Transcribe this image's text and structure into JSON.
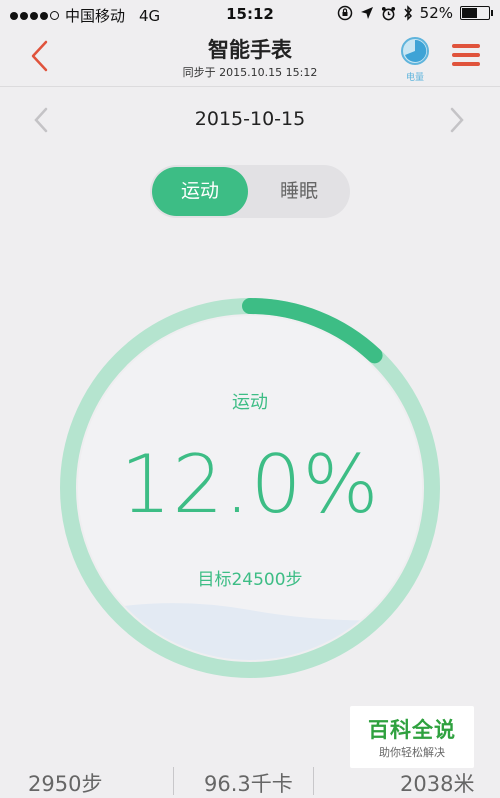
{
  "status_bar": {
    "carrier": "中国移动",
    "network": "4G",
    "time": "15:12",
    "battery": "52%"
  },
  "header": {
    "title": "智能手表",
    "subtitle": "同步于 2015.10.15 15:12",
    "power_label": "电量",
    "accent_color": "#e0533c"
  },
  "date": "2015-10-15",
  "tabs": [
    {
      "label": "运动",
      "active": true
    },
    {
      "label": "睡眠",
      "active": false
    }
  ],
  "ring": {
    "label": "运动",
    "value": "12.0%",
    "progress": 0.12,
    "goal": "目标24500步",
    "color": "#3dbd85",
    "track_color": "#b5e4cf"
  },
  "stats": [
    "2950步",
    "96.3千卡",
    "2038米"
  ],
  "watermark": {
    "title": "百科全说",
    "subtitle": "助你轻松解决"
  }
}
